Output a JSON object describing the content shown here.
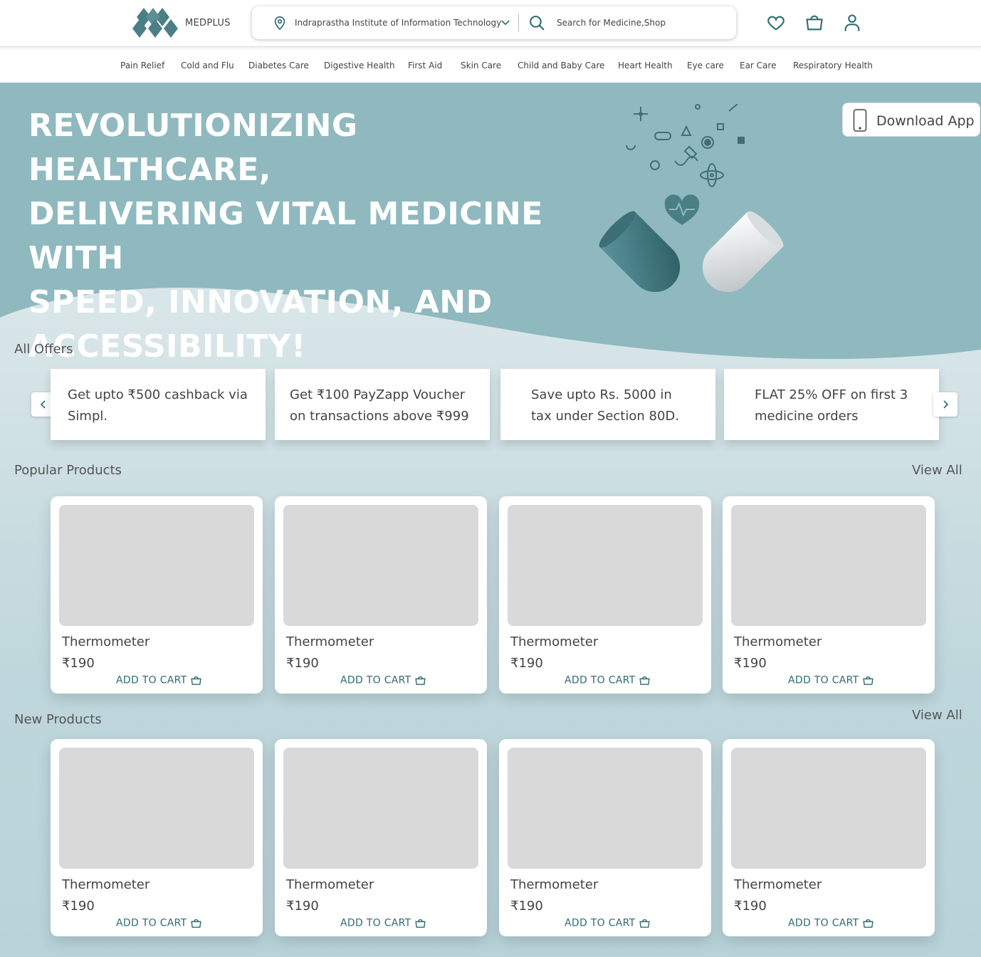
{
  "header": {
    "brand": "MEDPLUS",
    "location": "Indraprastha Institute of Information Technology",
    "search_placeholder": "Search for Medicine,Shop",
    "icons": [
      "location-icon",
      "chevron-down-icon",
      "search-icon",
      "heart-icon",
      "shopping-bag-icon",
      "user-icon"
    ]
  },
  "categories": [
    "Pain Relief",
    "Cold and Flu",
    "Diabetes Care",
    "Digestive Health",
    "First Aid",
    "Skin Care",
    "Child and Baby Care",
    "Heart Health",
    "Eye care",
    "Ear Care",
    "Respiratory Health"
  ],
  "hero": {
    "title_lines": [
      "REVOLUTIONIZING HEALTHCARE,",
      "DELIVERING VITAL MEDICINE WITH",
      "SPEED, INNOVATION, AND",
      "ACCESSIBILITY!"
    ],
    "download_label": "Download App"
  },
  "offers": {
    "title": "All Offers",
    "items": [
      [
        "Get upto ₹500 cashback via",
        "Simpl."
      ],
      [
        "Get ₹100 PayZapp Voucher",
        "on transactions above ₹999"
      ],
      [
        "Save upto Rs. 5000 in",
        "tax under Section 80D."
      ],
      [
        "FLAT 25% OFF on first 3",
        "medicine orders"
      ]
    ]
  },
  "popular": {
    "title": "Popular Products",
    "view_all": "View All",
    "products": [
      {
        "name": "Thermometer",
        "price": "₹190",
        "cta": "ADD TO CART"
      },
      {
        "name": "Thermometer",
        "price": "₹190",
        "cta": "ADD TO CART"
      },
      {
        "name": "Thermometer",
        "price": "₹190",
        "cta": "ADD TO CART"
      },
      {
        "name": "Thermometer",
        "price": "₹190",
        "cta": "ADD TO CART"
      }
    ]
  },
  "new_products": {
    "title": "New Products",
    "view_all": "View All",
    "products": [
      {
        "name": "Thermometer",
        "price": "₹190",
        "cta": "ADD TO CART"
      },
      {
        "name": "Thermometer",
        "price": "₹190",
        "cta": "ADD TO CART"
      },
      {
        "name": "Thermometer",
        "price": "₹190",
        "cta": "ADD TO CART"
      },
      {
        "name": "Thermometer",
        "price": "₹190",
        "cta": "ADD TO CART"
      }
    ]
  },
  "colors": {
    "accent": "#2e6b72",
    "hero_bg": "#8fb9bf",
    "logo": "#4b7f86"
  }
}
